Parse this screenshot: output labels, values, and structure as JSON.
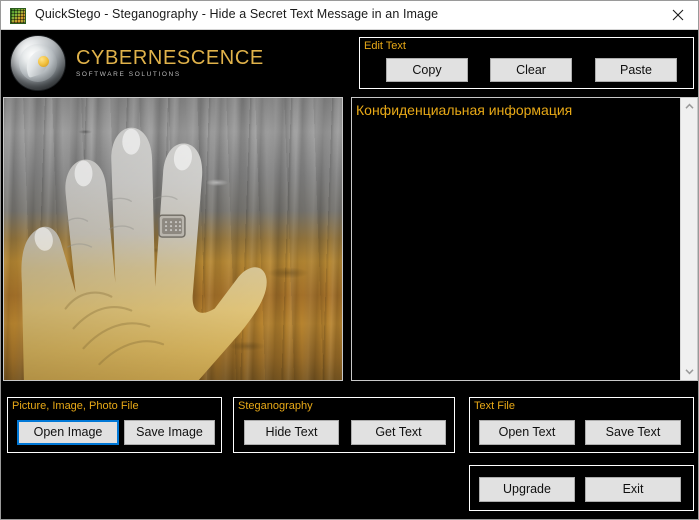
{
  "window": {
    "title": "QuickStego - Steganography - Hide a Secret Text Message in an Image",
    "icon": "app-mosaic-icon",
    "close_label": "✕"
  },
  "branding": {
    "name": "CYBERNESCENCE",
    "tagline": "SOFTWARE SOLUTIONS",
    "accent_color": "#e0b24a"
  },
  "edit_text_group": {
    "label": "Edit Text",
    "buttons": [
      {
        "label": "Copy"
      },
      {
        "label": "Clear"
      },
      {
        "label": "Paste"
      }
    ]
  },
  "text_editor": {
    "value": "Конфиденциальная информация",
    "text_color": "#e8a917",
    "background_color": "#000000",
    "scrollbar": {
      "up_arrow": "chevron-up-icon",
      "down_arrow": "chevron-down-icon"
    }
  },
  "image_preview": {
    "description": "Hand pressed on weathered wooden planks, grayscale fading to sepia"
  },
  "picture_group": {
    "label": "Picture, Image, Photo File",
    "buttons": [
      {
        "label": "Open Image",
        "focused": true
      },
      {
        "label": "Save Image",
        "focused": false
      }
    ]
  },
  "steganography_group": {
    "label": "Steganography",
    "buttons": [
      {
        "label": "Hide Text"
      },
      {
        "label": "Get Text"
      }
    ]
  },
  "text_file_group": {
    "label": "Text File",
    "buttons": [
      {
        "label": "Open Text"
      },
      {
        "label": "Save Text"
      }
    ]
  },
  "actions_group": {
    "buttons": [
      {
        "label": "Upgrade"
      },
      {
        "label": "Exit"
      }
    ]
  },
  "theme": {
    "window_background": "#000000",
    "group_border": "#ffffff",
    "group_label_color": "#e8a917",
    "button_face": "#e1e1e1",
    "button_border": "#adadad",
    "focus_ring": "#0078d7",
    "titlebar_background": "#ffffff",
    "titlebar_text": "#1a1a1a"
  }
}
